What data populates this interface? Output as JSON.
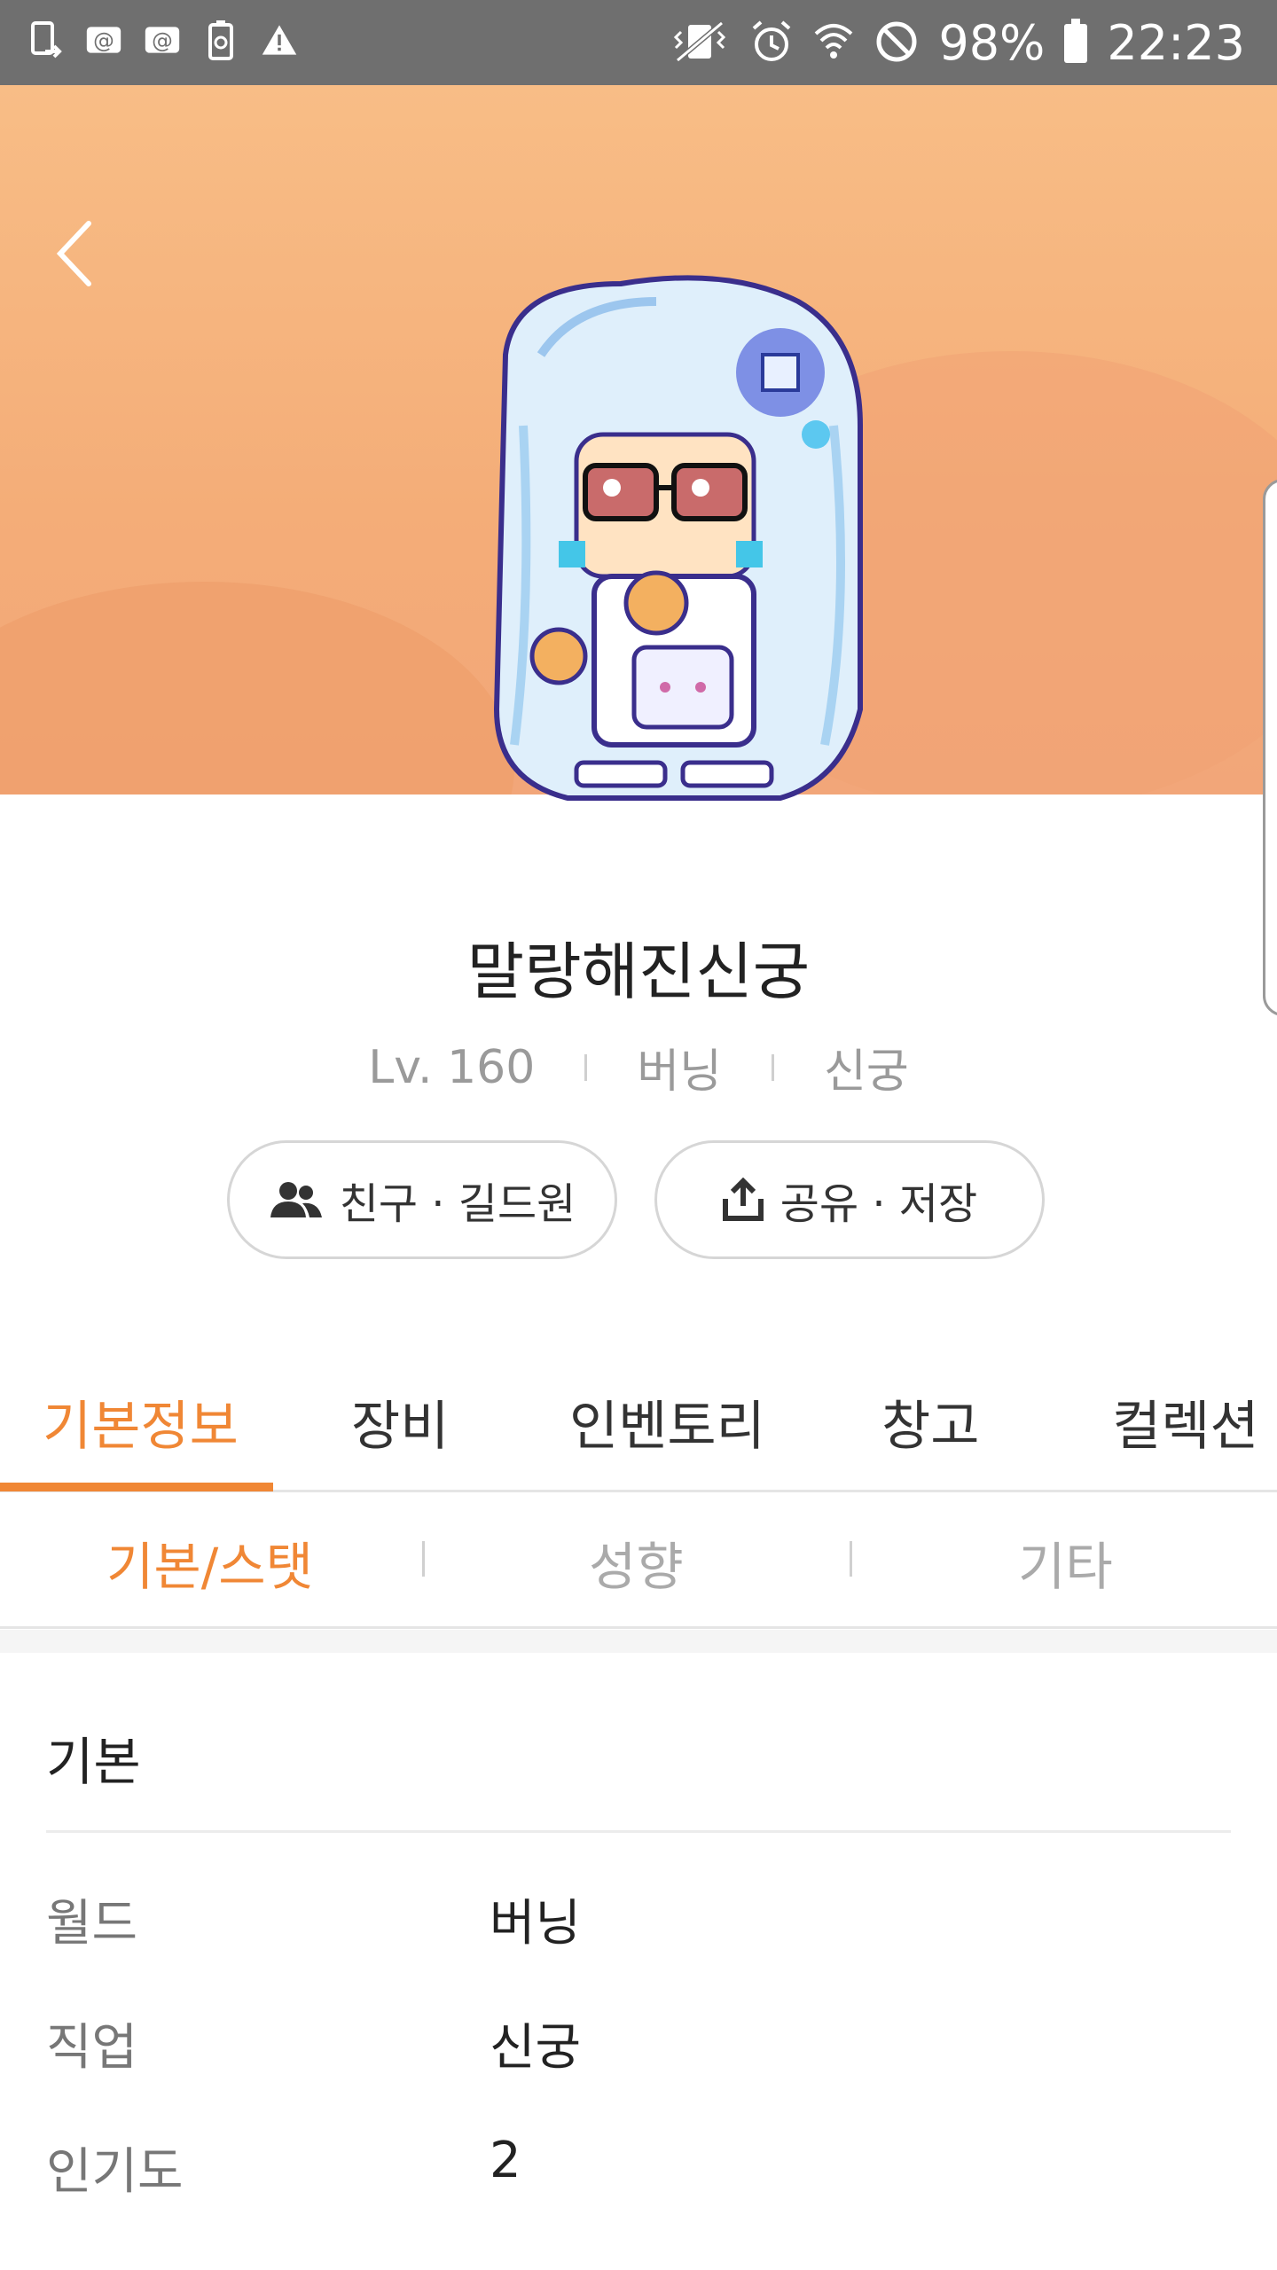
{
  "status_bar": {
    "battery": "98%",
    "time": "22:23",
    "icons_left": [
      "phone-transfer-icon",
      "email-icon",
      "email-icon",
      "recycle-icon",
      "warning-icon"
    ],
    "icons_right": [
      "vibrate-icon",
      "alarm-icon",
      "wifi-icon",
      "blocked-icon",
      "battery-icon"
    ]
  },
  "header": {
    "back_icon": "chevron-left-icon"
  },
  "profile": {
    "name": "말랑해진신궁",
    "level": "Lv. 160",
    "world": "버닝",
    "job": "신궁",
    "buttons": [
      {
        "label": "친구 · 길드원",
        "icon": "people-icon"
      },
      {
        "label": "공유 · 저장",
        "icon": "share-icon"
      }
    ]
  },
  "tabs": [
    "기본정보",
    "장비",
    "인벤토리",
    "창고",
    "컬렉션"
  ],
  "active_tab": "기본정보",
  "subtabs": [
    "기본/스탯",
    "성향",
    "기타"
  ],
  "active_subtab": "기본/스탯",
  "section": {
    "title": "기본",
    "rows": [
      {
        "label": "월드",
        "value": "버닝"
      },
      {
        "label": "직업",
        "value": "신궁"
      },
      {
        "label": "인기도",
        "value": "2"
      }
    ]
  },
  "colors": {
    "accent": "#f08735",
    "banner": "#f4ad78",
    "status_bar": "#6f6f6f"
  }
}
